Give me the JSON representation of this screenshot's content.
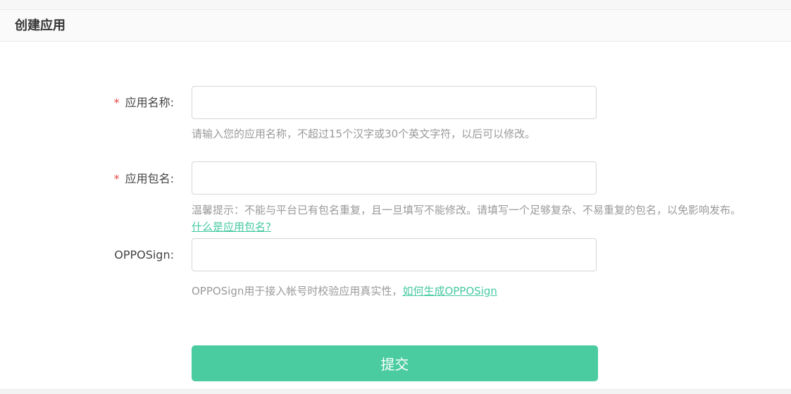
{
  "header": {
    "title": "创建应用"
  },
  "form": {
    "app_name": {
      "required_mark": "*",
      "label": "应用名称:",
      "value": "",
      "hint": "请输入您的应用名称，不超过15个汉字或30个英文字符，以后可以修改。"
    },
    "package_name": {
      "required_mark": "*",
      "label": "应用包名:",
      "value": "",
      "hint": "温馨提示：不能与平台已有包名重复，且一旦填写不能修改。请填写一个足够复杂、不易重复的包名，以免影响发布。",
      "help_link": "什么是应用包名?"
    },
    "oppo_sign": {
      "label": "OPPOSign:",
      "value": "",
      "hint": "OPPOSign用于接入帐号时校验应用真实性，",
      "help_link": "如何生成OPPOSign"
    },
    "submit_label": "提交"
  },
  "colors": {
    "accent": "#4acba0",
    "required": "#e64545",
    "link": "#46c9a1"
  }
}
